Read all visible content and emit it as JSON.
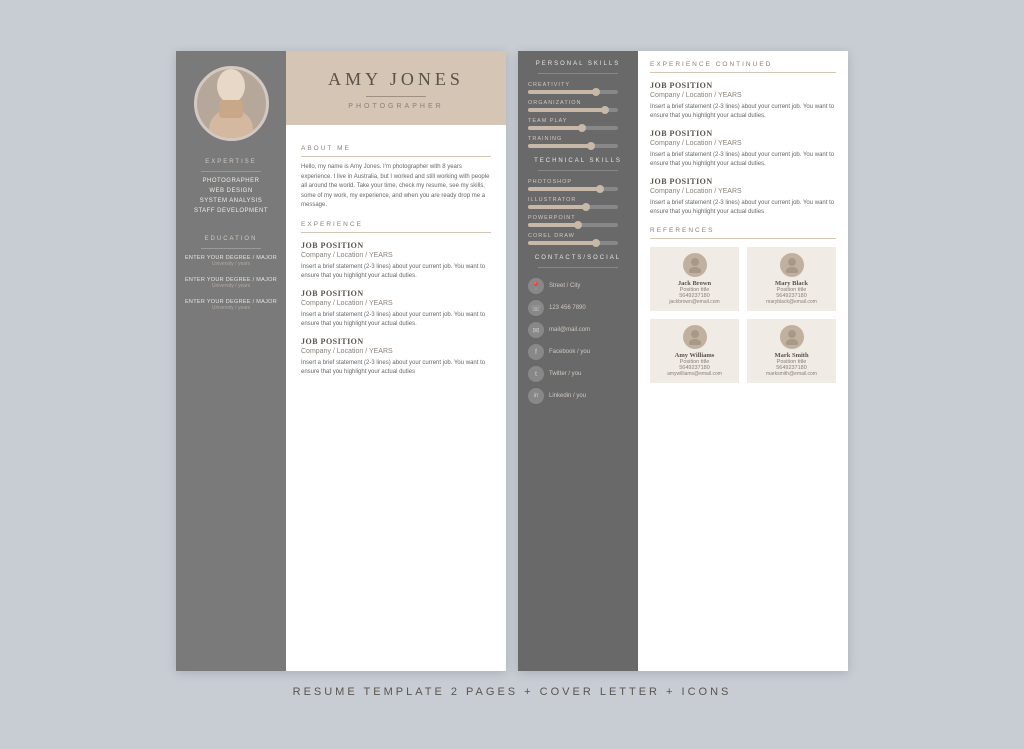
{
  "page": {
    "background_color": "#c8cdd4",
    "bottom_label": "RESUME TEMPLATE 2 PAGES + COVER LETTER + ICONS"
  },
  "page1": {
    "sidebar": {
      "expertise_title": "EXPERTISE",
      "expertise_items": [
        "PHOTOGRAPHER",
        "WEB DESIGN",
        "SYSTEM ANALYSIS",
        "STAFF DEVELOPMENT"
      ],
      "education_title": "EDUCATION",
      "education_entries": [
        {
          "degree": "ENTER YOUR DEGREE / MAJOR",
          "university": "University / years"
        },
        {
          "degree": "ENTER YOUR DEGREE / MAJOR",
          "university": "University / years"
        },
        {
          "degree": "ENTER YOUR DEGREE / MAJOR",
          "university": "University / years"
        }
      ]
    },
    "header": {
      "name": "AMY JONES",
      "job_title": "PHOTOGRAPHER"
    },
    "about": {
      "label": "ABOUT ME",
      "text": "Hello, my name is Amy Jones. I'm photographer with 8 years experience. I live in Australia, but I worked and still working with people all around the world. Take your time, check my resume, see my skills, some of my work, my experience, and when you are ready drop me a message."
    },
    "experience": {
      "label": "EXPERIENCE",
      "jobs": [
        {
          "position": "JOB POSITION",
          "company": "Company / Location / YEARS",
          "desc": "Insert a brief statement (2-3 lines) about your current job. You want to ensure that you highlight your actual duties."
        },
        {
          "position": "JOB POSITION",
          "company": "Company / Location / YEARS",
          "desc": "Insert a brief statement (2-3 lines) about your current job. You want to ensure that you highlight your actual duties."
        },
        {
          "position": "JOB POSITION",
          "company": "Company / Location / YEARS",
          "desc": "Insert a brief statement (2-3 lines) about your current job. You want to ensure that you highlight your actual duties"
        }
      ]
    }
  },
  "page2": {
    "skills": {
      "personal_title": "PERSONAL SKILLS",
      "personal_items": [
        {
          "name": "CREATIVITY",
          "pct": 75
        },
        {
          "name": "ORGANIZATION",
          "pct": 85
        },
        {
          "name": "TEAM PLAY",
          "pct": 60
        },
        {
          "name": "TRAINING",
          "pct": 70
        }
      ],
      "technical_title": "TECHNICAL SKILLS",
      "technical_items": [
        {
          "name": "PHOTOSHOP",
          "pct": 80
        },
        {
          "name": "ILLUSTRATOR",
          "pct": 65
        },
        {
          "name": "POWERPOINT",
          "pct": 55
        },
        {
          "name": "COREL DRAW",
          "pct": 75
        }
      ],
      "contacts_title": "CONTACTS/SOCIAL",
      "contacts": [
        {
          "icon": "📍",
          "text": "Street / City"
        },
        {
          "icon": "📞",
          "text": "123 456 7890"
        },
        {
          "icon": "✉",
          "text": "mail@mail.com"
        },
        {
          "icon": "f",
          "text": "Facebook / you"
        },
        {
          "icon": "t",
          "text": "Twitter / you"
        },
        {
          "icon": "in",
          "text": "Linkedin / you"
        }
      ]
    },
    "experience_continued": {
      "title": "EXPERIENCE CONTINUED",
      "jobs": [
        {
          "position": "JOB POSITION",
          "company": "Company / Location / YEARS",
          "desc": "Insert a brief statement (2-3 lines) about your current job. You want to ensure that you highlight your actual duties."
        },
        {
          "position": "JOB POSITION",
          "company": "Company / Location / YEARS",
          "desc": "Insert a brief statement (2-3 lines) about your current job. You want to ensure that you highlight your actual duties."
        },
        {
          "position": "JOB POSITION",
          "company": "Company / Location / YEARS",
          "desc": "Insert a brief statement (2-3 lines) about your current job. You want to ensure that you highlight your actual duties"
        }
      ]
    },
    "references": {
      "title": "REFERENCES",
      "people": [
        {
          "name": "Jack Brown",
          "position": "Position title",
          "phone": "5649237180",
          "email": "jackbrown@email.com"
        },
        {
          "name": "Mary Black",
          "position": "Position title",
          "phone": "5649237180",
          "email": "maryblack@email.com"
        },
        {
          "name": "Amy Williams",
          "position": "Position title",
          "phone": "5649237180",
          "email": "amywilliams@email.com"
        },
        {
          "name": "Mark Smith",
          "position": "Position title",
          "phone": "5649237180",
          "email": "marksmith@email.com"
        }
      ]
    }
  }
}
